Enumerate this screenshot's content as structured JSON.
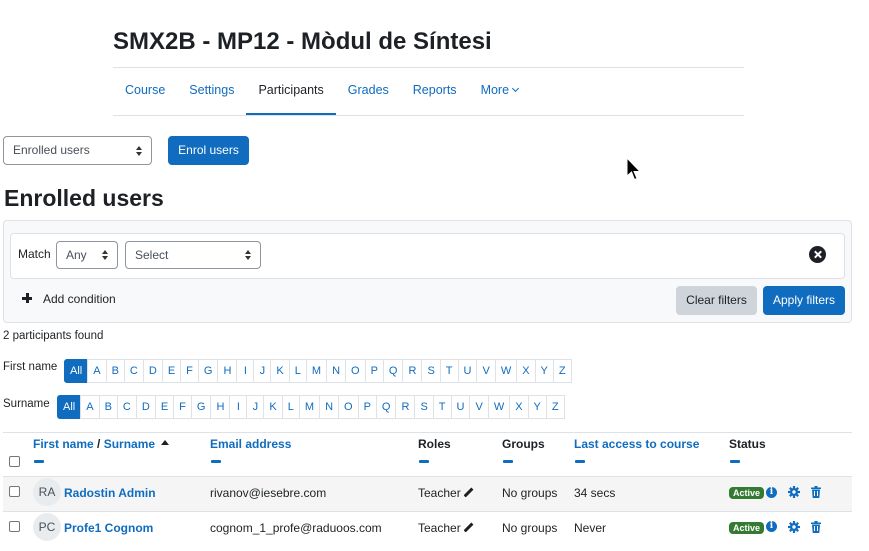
{
  "course": {
    "title": "SMX2B - MP12 - Mòdul de Síntesi"
  },
  "nav": {
    "items": [
      {
        "label": "Course"
      },
      {
        "label": "Settings"
      },
      {
        "label": "Participants",
        "active": true
      },
      {
        "label": "Grades"
      },
      {
        "label": "Reports"
      },
      {
        "label": "More"
      }
    ]
  },
  "toolbar": {
    "page_select_value": "Enrolled users",
    "enrol_button": "Enrol users"
  },
  "heading": "Enrolled users",
  "filters": {
    "match_label": "Match",
    "match_value": "Any",
    "type_value": "Select",
    "add_condition": "Add condition",
    "clear_button": "Clear filters",
    "apply_button": "Apply filters"
  },
  "participants_found": "2 participants found",
  "initials": {
    "firstname_label": "First name",
    "surname_label": "Surname",
    "all_label": "All",
    "letters": [
      "A",
      "B",
      "C",
      "D",
      "E",
      "F",
      "G",
      "H",
      "I",
      "J",
      "K",
      "L",
      "M",
      "N",
      "O",
      "P",
      "Q",
      "R",
      "S",
      "T",
      "U",
      "V",
      "W",
      "X",
      "Y",
      "Z"
    ]
  },
  "table": {
    "headers": {
      "first_name": "First name",
      "separator": " / ",
      "surname": "Surname",
      "email": "Email address",
      "roles": "Roles",
      "groups": "Groups",
      "last_access": "Last access to course",
      "status": "Status"
    },
    "rows": [
      {
        "initials": "RA",
        "name": "Radostin Admin",
        "email": "rivanov@iesebre.com",
        "role": "Teacher",
        "groups": "No groups",
        "last_access": "34 secs",
        "status": "Active"
      },
      {
        "initials": "PC",
        "name": "Profe1 Cognom",
        "email": "cognom_1_profe@raduoos.com",
        "role": "Teacher",
        "groups": "No groups",
        "last_access": "Never",
        "status": "Active"
      }
    ]
  },
  "colors": {
    "brand": "#0f6cbf",
    "active_badge": "#357a32",
    "text": "#1d2125"
  },
  "icons": {
    "more": "chevron-down-icon",
    "remove_filter": "close-circle-icon",
    "add": "plus-icon",
    "sort": "sort-ascending-icon",
    "role_edit": "pencil-icon",
    "info": "info-icon",
    "settings": "gear-icon",
    "delete": "trash-icon"
  }
}
